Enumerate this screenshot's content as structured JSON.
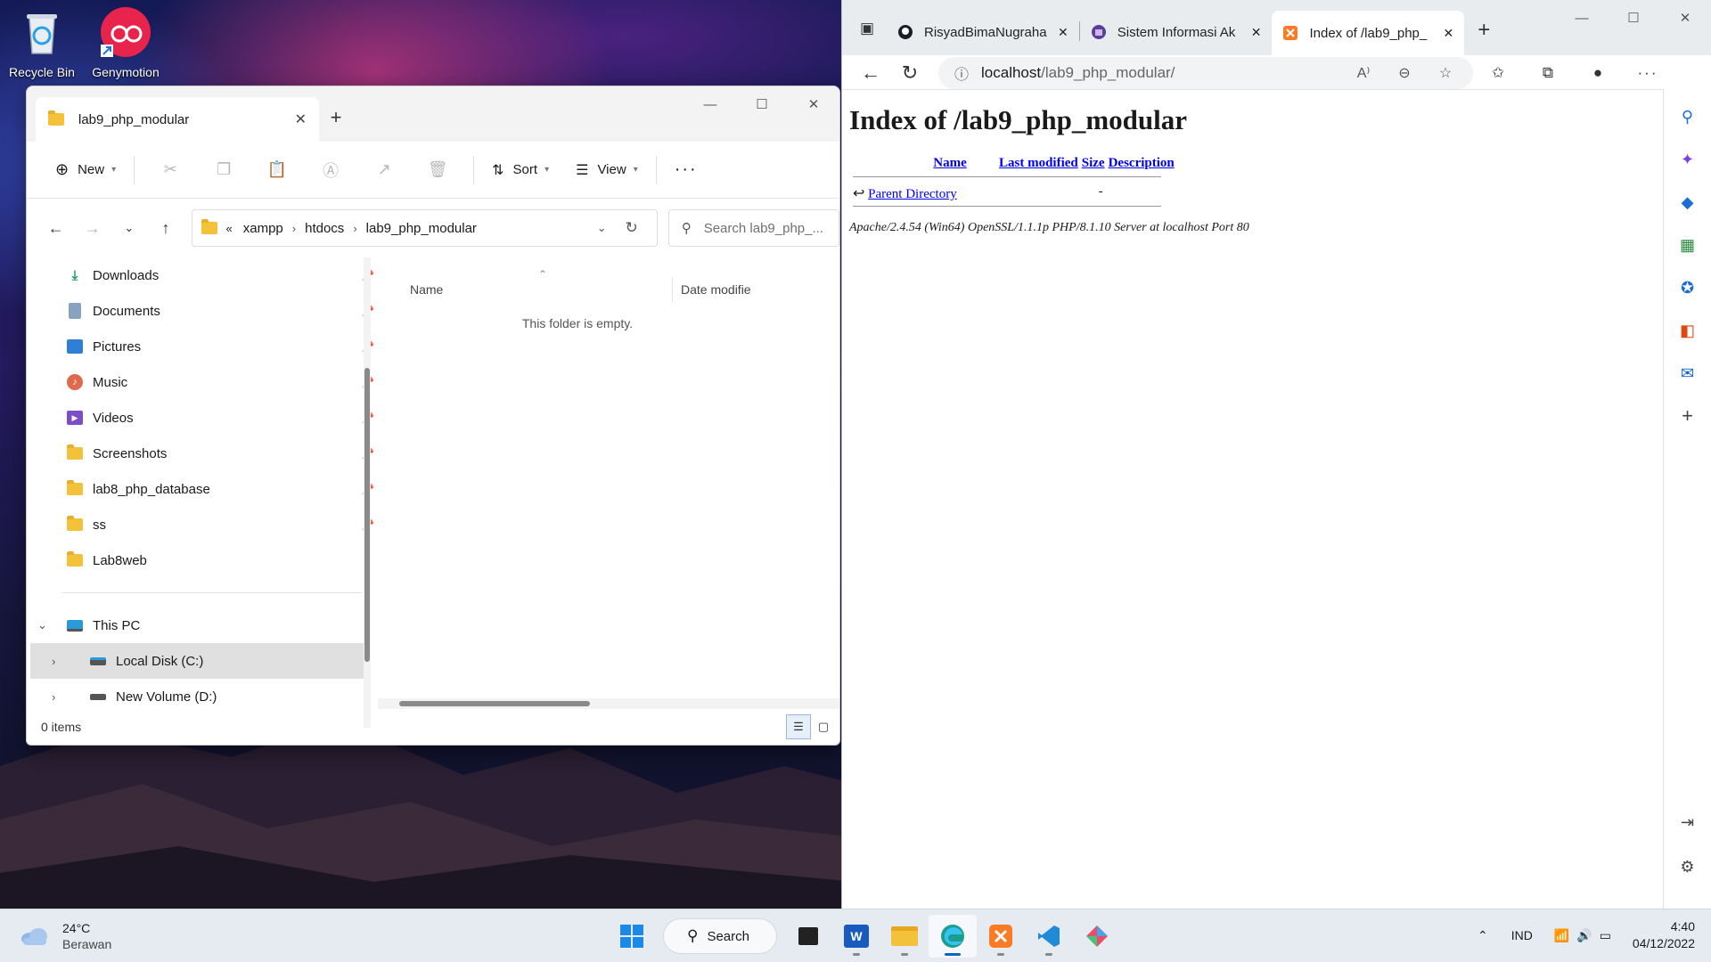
{
  "desktop": {
    "icons": [
      {
        "label": "Recycle Bin"
      },
      {
        "label": "Genymotion"
      }
    ]
  },
  "explorer": {
    "tab_title": "lab9_php_modular",
    "toolbar": {
      "new_label": "New",
      "sort_label": "Sort",
      "view_label": "View"
    },
    "breadcrumb": [
      "xampp",
      "htdocs",
      "lab9_php_modular"
    ],
    "search_placeholder": "Search lab9_php_...",
    "nav_items": [
      {
        "label": "Downloads",
        "icon": "download-icon",
        "pinned": true
      },
      {
        "label": "Documents",
        "icon": "documents-icon",
        "pinned": true
      },
      {
        "label": "Pictures",
        "icon": "pictures-icon",
        "pinned": true
      },
      {
        "label": "Music",
        "icon": "music-icon",
        "pinned": true
      },
      {
        "label": "Videos",
        "icon": "videos-icon",
        "pinned": true
      },
      {
        "label": "Screenshots",
        "icon": "folder-icon",
        "pinned": true
      },
      {
        "label": "lab8_php_database",
        "icon": "folder-icon",
        "pinned": true
      },
      {
        "label": "ss",
        "icon": "folder-icon",
        "pinned": true
      },
      {
        "label": "Lab8web",
        "icon": "folder-icon",
        "pinned": false
      }
    ],
    "this_pc": "This PC",
    "drives": [
      {
        "label": "Local Disk (C:)",
        "selected": true
      },
      {
        "label": "New Volume (D:)",
        "selected": false
      }
    ],
    "columns": {
      "name": "Name",
      "date": "Date modifie"
    },
    "empty_message": "This folder is empty.",
    "status": "0 items"
  },
  "browser": {
    "tabs": [
      {
        "title": "RisyadBimaNugraha",
        "favicon": "github-icon"
      },
      {
        "title": "Sistem Informasi Ak",
        "favicon": "university-icon"
      },
      {
        "title": "Index of /lab9_php_",
        "favicon": "xampp-icon",
        "active": true
      }
    ],
    "url_host": "localhost",
    "url_path": "/lab9_php_modular/",
    "page": {
      "heading": "Index of /lab9_php_modular",
      "headers": {
        "name": "Name",
        "modified": "Last modified",
        "size": "Size",
        "description": "Description"
      },
      "rows": [
        {
          "name": "Parent Directory",
          "modified": "",
          "size": "-",
          "description": ""
        }
      ],
      "footer": "Apache/2.4.54 (Win64) OpenSSL/1.1.1p PHP/8.1.10 Server at localhost Port 80"
    }
  },
  "taskbar": {
    "weather_temp": "24°C",
    "weather_desc": "Berawan",
    "search_label": "Search",
    "language": "IND",
    "time": "4:40",
    "date": "04/12/2022"
  }
}
